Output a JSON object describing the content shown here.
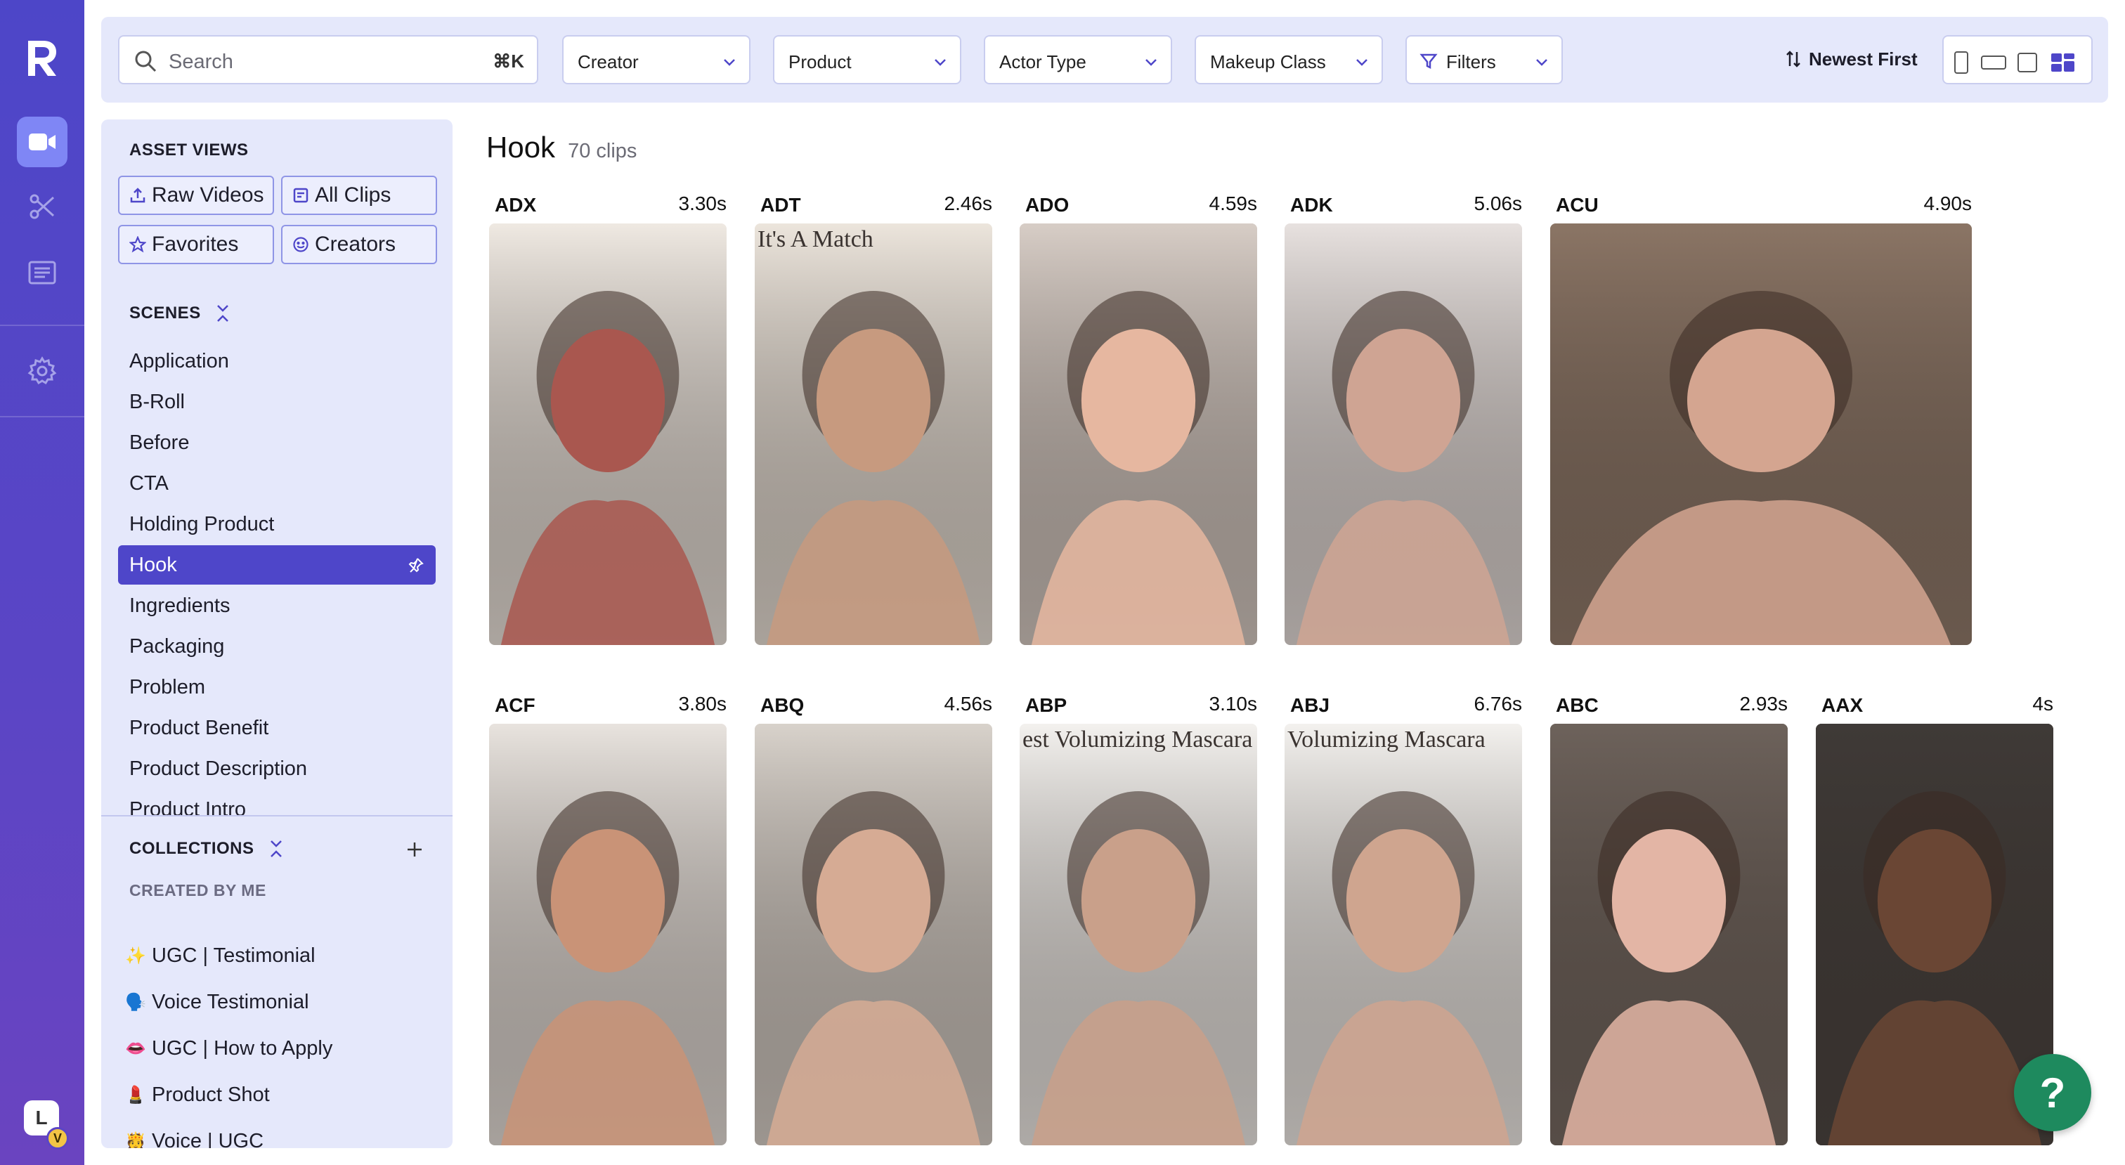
{
  "brand": {
    "logo_letter": "R"
  },
  "rail": {
    "items": [
      {
        "name": "video-icon",
        "active": true
      },
      {
        "name": "scissors-icon",
        "active": false
      },
      {
        "name": "list-icon",
        "active": false
      },
      {
        "name": "gear-icon",
        "active": false
      }
    ],
    "avatar_letter": "L",
    "avatar_badge": "V"
  },
  "topbar": {
    "search_placeholder": "Search",
    "search_shortcut": "⌘K",
    "dropdowns": [
      "Creator",
      "Product",
      "Actor Type",
      "Makeup Class"
    ],
    "filters_label": "Filters",
    "sort_label": "Newest First"
  },
  "sidebar": {
    "asset_views_title": "ASSET VIEWS",
    "asset_views": [
      {
        "label": "Raw Videos",
        "icon": "upload-icon"
      },
      {
        "label": "All Clips",
        "icon": "clips-icon"
      },
      {
        "label": "Favorites",
        "icon": "star-icon"
      },
      {
        "label": "Creators",
        "icon": "smiley-icon"
      }
    ],
    "scenes_title": "SCENES",
    "scenes": [
      "Application",
      "B-Roll",
      "Before",
      "CTA",
      "Holding Product",
      "Hook",
      "Ingredients",
      "Packaging",
      "Problem",
      "Product Benefit",
      "Product Description",
      "Product Intro"
    ],
    "active_scene": "Hook",
    "collections_title": "COLLECTIONS",
    "created_by_me": "CREATED BY ME",
    "collections": [
      {
        "emoji": "✨",
        "label": "UGC | Testimonial"
      },
      {
        "emoji": "🗣️",
        "label": "Voice Testimonial"
      },
      {
        "emoji": "👄",
        "label": "UGC | How to Apply"
      },
      {
        "emoji": "💄",
        "label": "Product Shot"
      },
      {
        "emoji": "🫅",
        "label": "Voice | UGC"
      }
    ]
  },
  "main": {
    "title": "Hook",
    "count": "70 clips",
    "clips": [
      {
        "code": "ADX",
        "duration": "3.30s",
        "tone": "#a9574f",
        "bg": "#efe9e2"
      },
      {
        "code": "ADT",
        "duration": "2.46s",
        "tone": "#c79a7f",
        "bg": "#ece5dc",
        "overlay": "It's A Match"
      },
      {
        "code": "ADO",
        "duration": "4.59s",
        "tone": "#e6b7a0",
        "bg": "#d7cdc6"
      },
      {
        "code": "ADK",
        "duration": "5.06s",
        "tone": "#cfa493",
        "bg": "#e7e1df"
      },
      {
        "code": "ACU",
        "duration": "4.90s",
        "tone": "#d4a590",
        "bg": "#8b7565"
      },
      {
        "code": "ACF",
        "duration": "3.80s",
        "tone": "#c99377",
        "bg": "#e8e3de"
      },
      {
        "code": "ABQ",
        "duration": "4.56s",
        "tone": "#d6ab94",
        "bg": "#d8d2cb"
      },
      {
        "code": "ABP",
        "duration": "3.10s",
        "tone": "#c9a08a",
        "bg": "#f3f1ee",
        "overlay": "est Volumizing Mascara"
      },
      {
        "code": "ABJ",
        "duration": "6.76s",
        "tone": "#cfa58f",
        "bg": "#f3f1ee",
        "overlay": "Volumizing Mascara"
      },
      {
        "code": "ABC",
        "duration": "2.93s",
        "tone": "#e3b5a5",
        "bg": "#6d625b"
      },
      {
        "code": "AAX",
        "duration": "4s",
        "tone": "#6a4634",
        "bg": "#3f3a37"
      }
    ]
  },
  "help_label": "?"
}
